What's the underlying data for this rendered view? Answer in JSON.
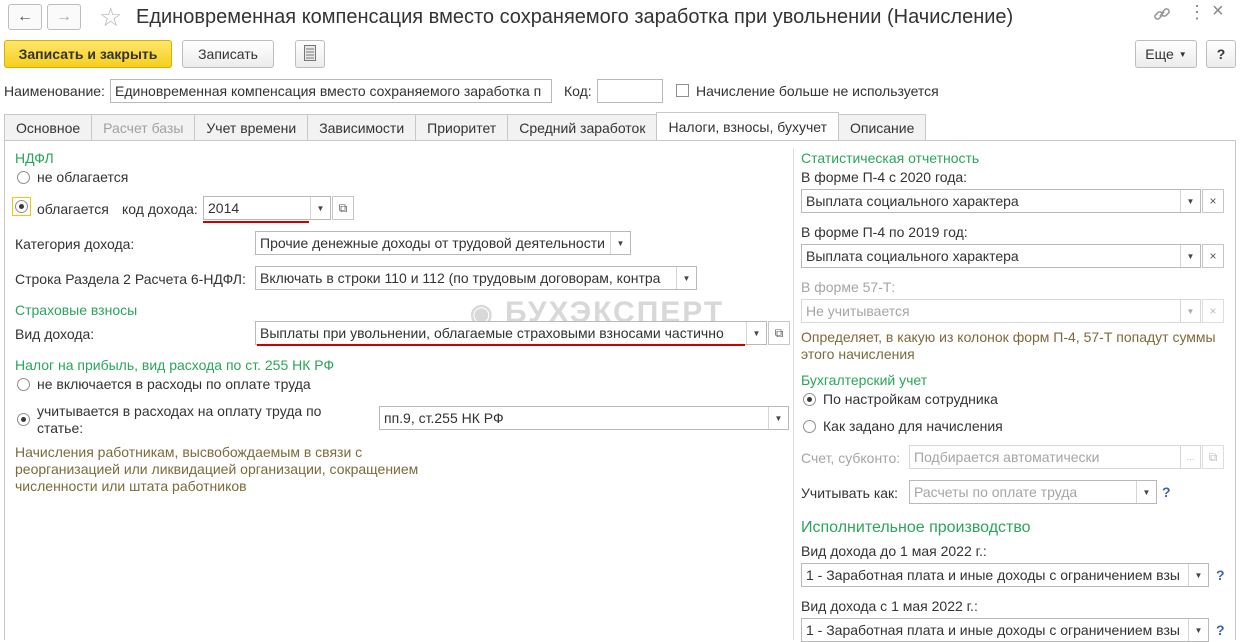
{
  "window": {
    "title": "Единовременная компенсация вместо сохраняемого заработка при увольнении (Начисление)"
  },
  "toolbar": {
    "save_close": "Записать и закрыть",
    "save": "Записать",
    "more": "Еще",
    "help": "?"
  },
  "header": {
    "name_label": "Наименование:",
    "name_value": "Единовременная компенсация вместо сохраняемого заработка п",
    "code_label": "Код:",
    "code_value": "",
    "unused_label": "Начисление больше не используется"
  },
  "tabs": [
    {
      "label": "Основное",
      "state": "normal"
    },
    {
      "label": "Расчет базы",
      "state": "disabled"
    },
    {
      "label": "Учет времени",
      "state": "normal"
    },
    {
      "label": "Зависимости",
      "state": "normal"
    },
    {
      "label": "Приоритет",
      "state": "normal"
    },
    {
      "label": "Средний заработок",
      "state": "normal"
    },
    {
      "label": "Налоги, взносы, бухучет",
      "state": "active"
    },
    {
      "label": "Описание",
      "state": "normal"
    }
  ],
  "watermark": "БУХЭКСПЕРТ",
  "left": {
    "ndfl_title": "НДФЛ",
    "ndfl_not_taxed": "не облагается",
    "ndfl_taxed": "облагается",
    "income_code_label": "код дохода:",
    "income_code_value": "2014",
    "income_category_label": "Категория дохода:",
    "income_category_value": "Прочие денежные доходы от трудовой деятельности",
    "row6_label": "Строка Раздела 2 Расчета 6-НДФЛ:",
    "row6_value": "Включать в строки 110 и 112 (по трудовым договорам, контра",
    "insurance_title": "Страховые взносы",
    "income_type_label": "Вид дохода:",
    "income_type_value": "Выплаты при увольнении, облагаемые страховыми взносами частично",
    "profit_tax_title": "Налог на прибыль, вид расхода по ст. 255 НК РФ",
    "profit_not_included": "не включается в расходы по оплате труда",
    "profit_included_line1": "учитывается в расходах на оплату труда по",
    "profit_included_line2": "статье:",
    "article_value": "пп.9, ст.255 НК РФ",
    "hint_line1": "Начисления работникам, высвобождаемым в связи с",
    "hint_line2": "реорганизацией или ликвидацией организации, сокращением",
    "hint_line3": "численности или штата работников"
  },
  "right": {
    "stat_title": "Статистическая отчетность",
    "p4_2020_label": "В форме П-4 с 2020 года:",
    "p4_2020_value": "Выплата социального характера",
    "p4_2019_label": "В форме П-4 по 2019 год:",
    "p4_2019_value": "Выплата социального характера",
    "f57_label": "В форме 57-Т:",
    "f57_value": "Не учитывается",
    "stat_hint_line1": "Определяет, в какую из колонок форм П-4, 57-Т попадут суммы",
    "stat_hint_line2": "этого начисления",
    "accounting_title": "Бухгалтерский учет",
    "acc_by_employee": "По настройкам сотрудника",
    "acc_as_set": "Как задано для начисления",
    "account_label": "Счет, субконто:",
    "account_value": "Подбирается автоматически",
    "consider_label": "Учитывать как:",
    "consider_value": "Расчеты по оплате труда",
    "exec_title": "Исполнительное производство",
    "exec_before_label": "Вид дохода до 1 мая 2022 г.:",
    "exec_before_value": "1 - Заработная плата и иные доходы с ограничением взы",
    "exec_after_label": "Вид дохода с 1 мая 2022 г.:",
    "exec_after_value": "1 - Заработная плата и иные доходы с ограничением взы"
  }
}
